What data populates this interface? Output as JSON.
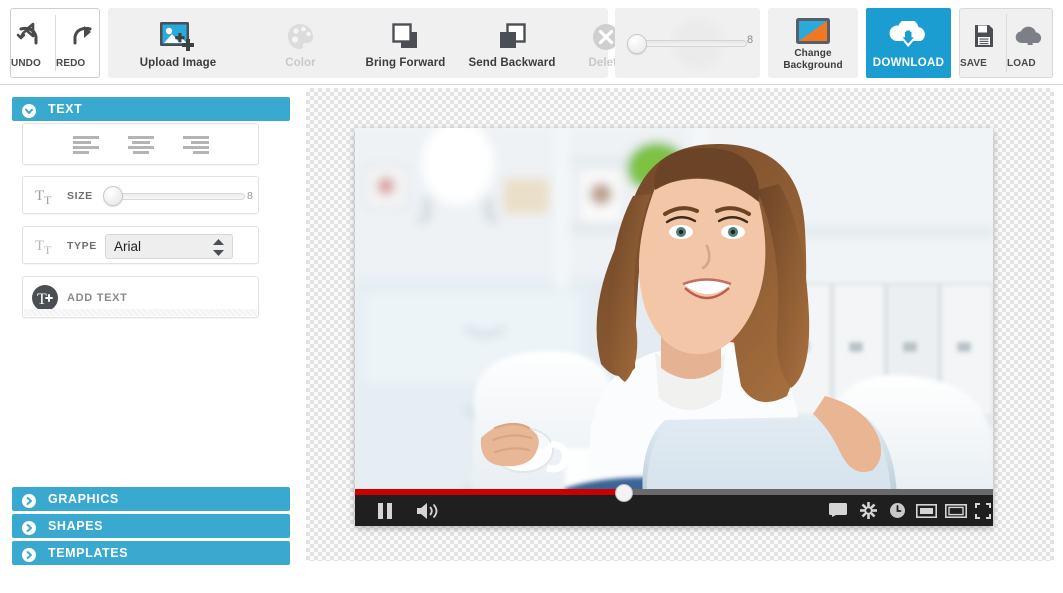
{
  "toolbar": {
    "undo": {
      "label": "UNDO",
      "icon": "undo-arrow-icon"
    },
    "redo": {
      "label": "REDO",
      "icon": "redo-arrow-icon"
    },
    "upload_image": {
      "label": "Upload Image",
      "icon": "image-plus-icon",
      "enabled": true
    },
    "color": {
      "label": "Color",
      "icon": "palette-icon",
      "enabled": false
    },
    "bring_forward": {
      "label": "Bring Forward",
      "icon": "bring-forward-icon",
      "enabled": true
    },
    "send_backward": {
      "label": "Send Backward",
      "icon": "send-backward-icon",
      "enabled": true
    },
    "delete": {
      "label": "Delete",
      "icon": "circle-x-icon",
      "enabled": false
    },
    "opacity_slider": {
      "value": "8",
      "knob_percent": 0
    },
    "change_background": {
      "label_line1": "Change",
      "label_line2": "Background",
      "icon": "background-swatch-icon"
    },
    "download": {
      "label": "DOWNLOAD",
      "icon": "cloud-download-icon",
      "color": "#1b9dd1"
    },
    "save": {
      "label": "SAVE",
      "icon": "floppy-disk-icon"
    },
    "load": {
      "label": "LOAD",
      "icon": "cloud-upload-icon"
    }
  },
  "sidebar": {
    "panels": [
      {
        "label": "TEXT",
        "state": "expanded",
        "icon": "chevron-down-circle-icon"
      },
      {
        "label": "GRAPHICS",
        "state": "collapsed",
        "icon": "chevron-right-circle-icon"
      },
      {
        "label": "SHAPES",
        "state": "collapsed",
        "icon": "chevron-right-circle-icon"
      },
      {
        "label": "TEMPLATES",
        "state": "collapsed",
        "icon": "chevron-right-circle-icon"
      }
    ],
    "text_panel": {
      "align": [
        {
          "name": "align-left",
          "icon": "align-left-icon"
        },
        {
          "name": "align-center",
          "icon": "align-center-icon"
        },
        {
          "name": "align-right",
          "icon": "align-right-icon"
        }
      ],
      "size": {
        "label": "SIZE",
        "value": "8",
        "icon": "text-size-icon",
        "knob_percent": 0
      },
      "type": {
        "label": "TYPE",
        "value": "Arial",
        "icon": "text-type-icon",
        "spinner": "up-down-arrows-icon"
      },
      "add_text": {
        "label": "ADD TEXT",
        "icon": "add-text-circle-icon"
      }
    }
  },
  "canvas": {
    "background": "transparency-checkerboard",
    "image": {
      "alt": "Smiling woman with long brown hair holding a coffee cup, sitting on a white sofa with a laptop in an office interior",
      "accent_binder": "#d94f2b"
    },
    "video_player": {
      "progress_percent": 42,
      "progress_color": "#cc0000",
      "buttons": [
        {
          "name": "pause-button",
          "icon": "pause-icon"
        },
        {
          "name": "volume-button",
          "icon": "volume-icon"
        },
        {
          "name": "captions-button",
          "icon": "captions-icon"
        },
        {
          "name": "settings-button",
          "icon": "gear-icon"
        },
        {
          "name": "watch-later-button",
          "icon": "clock-icon"
        },
        {
          "name": "theater-mode-button",
          "icon": "theater-screen-icon"
        },
        {
          "name": "miniplayer-button",
          "icon": "miniplayer-screen-icon"
        },
        {
          "name": "fullscreen-button",
          "icon": "fullscreen-icon"
        }
      ]
    }
  }
}
